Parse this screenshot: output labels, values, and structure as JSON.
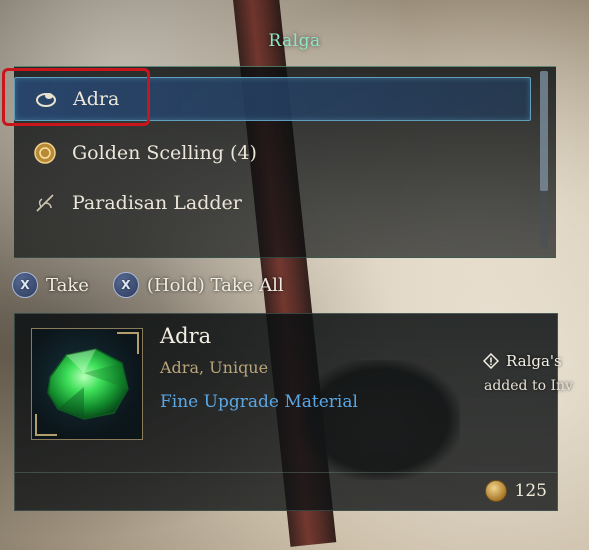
{
  "container": {
    "title": "Ralga"
  },
  "loot_list": {
    "items": [
      {
        "label": "Adra",
        "icon": "ring-icon",
        "selected": true
      },
      {
        "label": "Golden Scelling (4)",
        "icon": "gold-coin-icon",
        "selected": false
      },
      {
        "label": "Paradisan Ladder",
        "icon": "herb-icon",
        "selected": false
      }
    ]
  },
  "prompts": {
    "take": {
      "button": "X",
      "label": "Take"
    },
    "take_all": {
      "button": "X",
      "label": "(Hold) Take All"
    }
  },
  "detail": {
    "name": "Adra",
    "subtitle": "Adra, Unique",
    "type": "Fine Upgrade Material",
    "value": "125"
  },
  "notification": {
    "line1": "Ralga's",
    "line2": "added to Inv"
  },
  "colors": {
    "accent_teal": "#8fe6c6",
    "type_blue": "#5aa7e6",
    "highlight_red": "#c8161c",
    "rarity_gold": "#b9a57a"
  }
}
